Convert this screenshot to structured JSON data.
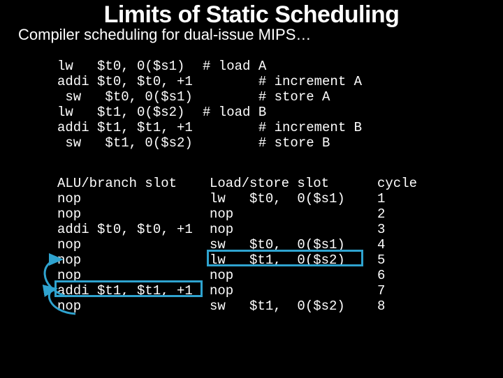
{
  "title": "Limits of Static Scheduling",
  "subtitle": "Compiler scheduling for dual-issue MIPS…",
  "asm_block": "lw   $t0, 0($s1)\naddi $t0, $t0, +1\n sw   $t0, 0($s1)\nlw   $t1, 0($s2)\naddi $t1, $t1, +1\n sw   $t1, 0($s2)",
  "comment_block": "# load A\n       # increment A\n       # store A\n# load B\n       # increment B\n       # store B",
  "alu_block": "ALU/branch slot\nnop\nnop\naddi $t0, $t0, +1\nnop\nnop\nnop\naddi $t1, $t1, +1\nnop",
  "ls_block": "Load/store slot\nlw   $t0,  0($s1)\nnop\nnop\nsw   $t0,  0($s1)\nlw   $t1,  0($s2)\nnop\nnop\nsw   $t1,  0($s2)",
  "cycle_block": "cycle\n1\n2\n3\n4\n5\n6\n7\n8"
}
